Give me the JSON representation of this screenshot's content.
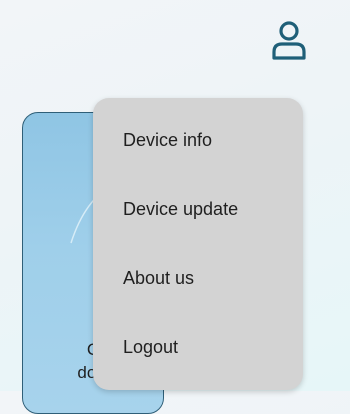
{
  "header": {
    "profile_icon": "user-icon",
    "accent_color": "#1f5f78"
  },
  "card": {
    "label_line1": "C",
    "label_line2": "dow"
  },
  "menu": {
    "items": [
      {
        "label": "Device info"
      },
      {
        "label": "Device update"
      },
      {
        "label": "About us"
      },
      {
        "label": "Logout"
      }
    ]
  }
}
